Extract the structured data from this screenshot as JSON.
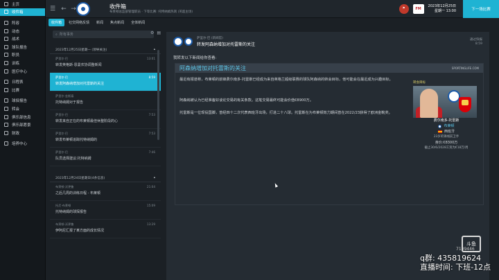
{
  "sidebar": {
    "items": [
      {
        "label": "主页",
        "icon": "home-icon"
      },
      {
        "label": "收件箱",
        "icon": "inbox-icon",
        "active": true
      },
      {
        "label": "阵容",
        "icon": "shirt-icon"
      },
      {
        "label": "动态",
        "icon": "dynamics-icon"
      },
      {
        "label": "战术",
        "icon": "tactics-icon"
      },
      {
        "label": "球队报告",
        "icon": "report-icon"
      },
      {
        "label": "职员",
        "icon": "staff-icon"
      },
      {
        "label": "训练",
        "icon": "training-icon"
      },
      {
        "label": "医疗中心",
        "icon": "medical-icon"
      },
      {
        "label": "日程表",
        "icon": "calendar-icon"
      },
      {
        "label": "比赛",
        "icon": "match-icon"
      },
      {
        "label": "球探报告",
        "icon": "scouting-icon"
      },
      {
        "label": "转会",
        "icon": "transfer-icon"
      },
      {
        "label": "俱乐部信息",
        "icon": "club-info-icon"
      },
      {
        "label": "俱乐部愿景",
        "icon": "vision-icon"
      },
      {
        "label": "财政",
        "icon": "finance-icon"
      },
      {
        "label": "培养中心",
        "icon": "development-icon"
      }
    ]
  },
  "topbar": {
    "title": "收件箱",
    "subtitle": "布莱顿总监部管理职员 · 下等比赛: 托特纳姆热刺 (英超主场)",
    "date_line1": "2023年12月25日",
    "date_line2": "星期一 13:00",
    "next_label": "下一场比赛"
  },
  "tabs": [
    {
      "label": "收件箱",
      "active": true
    },
    {
      "label": "社交网络反馈"
    },
    {
      "label": "新闻"
    },
    {
      "label": "焦点新闻"
    },
    {
      "label": "全体新闻"
    }
  ],
  "list": {
    "search_placeholder": "所有事务",
    "groups": [
      {
        "heading": "2023年12月25日星期一 (领导关注)",
        "messages": [
          {
            "from": "萨里尔·巴",
            "subject": "转发英格斯·恩曼农协调整新闻",
            "time": "13:01"
          },
          {
            "from": "萨里尔·巴",
            "subject": "转发阿森纳增加对托雷斯的关注",
            "time": "8:59",
            "selected": true
          },
          {
            "from": "萨里尔·金斯泰",
            "subject": "托特纳姆对于报告",
            "time": ""
          },
          {
            "from": "萨里尔·巴",
            "subject": "转发来自正在的布莱顿最佳休整阶段的心",
            "time": "7:53"
          },
          {
            "from": "萨里尔·巴",
            "subject": "转发布莱顿追踪托特纳姆的",
            "time": "7:53"
          },
          {
            "from": "萨里尔·巴",
            "subject": "队员选择建议:托特纳姆",
            "time": "7:46"
          }
        ]
      },
      {
        "heading": "2023年12月24日星期日(4条信息)",
        "messages": [
          {
            "from": "布莱顿·沃更鲁",
            "subject": "之后几周的训练日程 - 布莱顿",
            "time": "21:04"
          },
          {
            "from": "托尼·布莱顿",
            "subject": "托特纳姆的球探报告",
            "time": "15:09"
          },
          {
            "from": "布莱顿·沃更鲁",
            "subject": "伊阿尼汇报了某方面的成长情况",
            "time": "13:29"
          }
        ]
      }
    ]
  },
  "detail": {
    "from": "萨里尔·巴 (新闻官)",
    "subject": "转发阿森纳增加对托雷斯的关注",
    "right_line1": "通过快报",
    "right_line2": "8:59",
    "intro": "我转发以下新闻给你查看:",
    "article_title": "阿森纳增加对托雷斯的关注",
    "article_source": "SPORTINGLIFE.COM",
    "paragraphs": [
      "最近有报道称，布莱顿的前锋费尔南多·托雷斯已经成为来自英格兰超级联赛的球队阿森纳的转会目标，他可能会在最近成为兴趣目标。",
      "阿森纳被认为已经准备好谈论交易的有关条款。这笔交易最终可能会价值€8900万。",
      "托雷斯是一位现役国脚，曾经四十二次代表西班牙出场，打进二十八球。托雷斯在为布莱顿效力期间曾在2022/23获得了欧洲金靴奖。"
    ],
    "card": {
      "label": "转会目标",
      "name": "费尔南多·托雷斯",
      "club": "布莱顿",
      "nation": "西班牙",
      "age_line": "23岁的锋线前卫手",
      "value": "身价:€8300万",
      "contract": "截止30/6/2028工资为€18万/周"
    }
  },
  "overlay": {
    "qq": "q群: 435819624",
    "hours": "直播时间: 下班-12点",
    "room_id": "7109446",
    "logo": "斗鱼"
  },
  "colors": {
    "accent": "#1fb3d3",
    "sidebar_bg": "#14181c",
    "panel_bg": "#252c33",
    "headline": "#5ec6e8"
  }
}
